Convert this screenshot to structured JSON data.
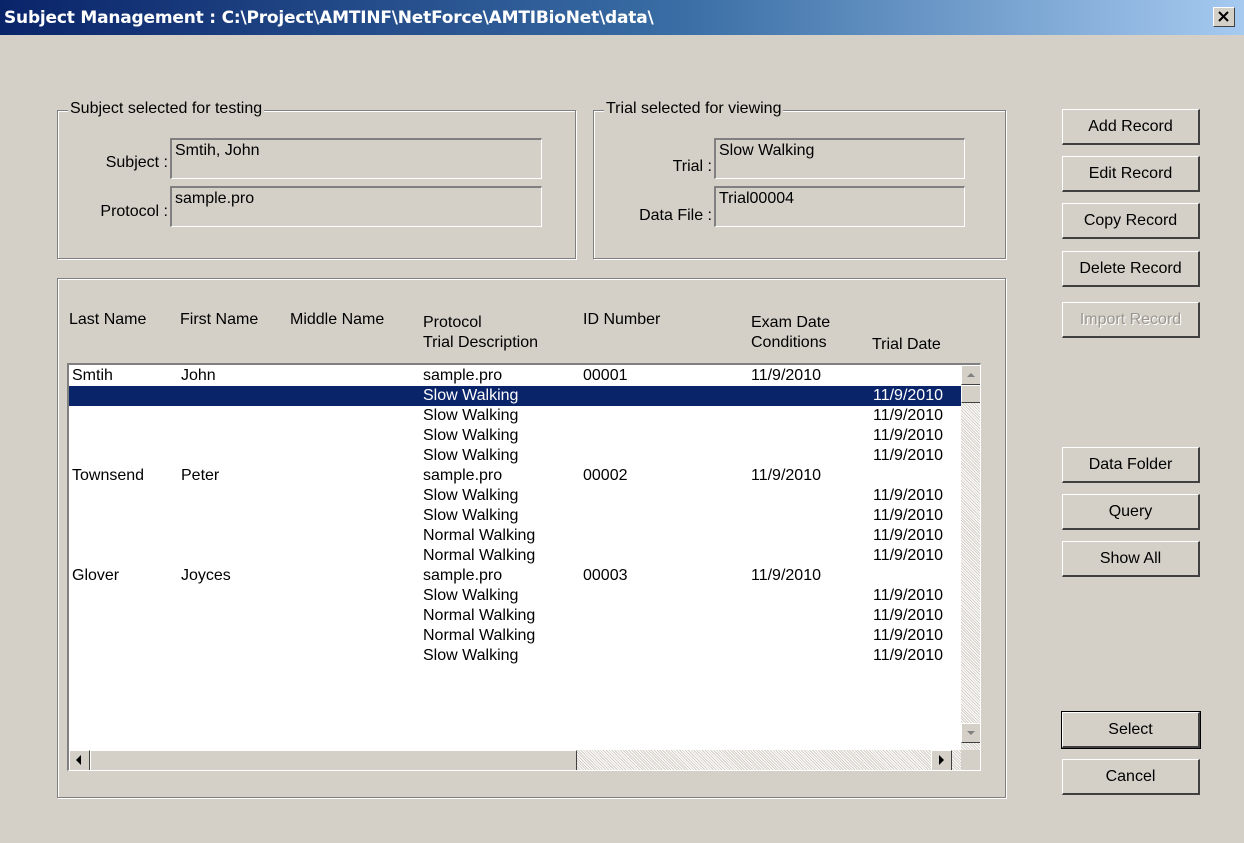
{
  "window": {
    "title": "Subject Management : C:\\Project\\AMTINF\\NetForce\\AMTIBioNet\\data\\"
  },
  "subject_group": {
    "title": "Subject selected for testing",
    "subject_label": "Subject :",
    "subject_value": "Smtih, John",
    "protocol_label": "Protocol :",
    "protocol_value": "sample.pro"
  },
  "trial_group": {
    "title": "Trial selected for viewing",
    "trial_label": "Trial :",
    "trial_value": "Slow Walking",
    "datafile_label": "Data File :",
    "datafile_value": "Trial00004"
  },
  "buttons": {
    "add": "Add Record",
    "edit": "Edit Record",
    "copy": "Copy Record",
    "delete": "Delete Record",
    "import": "Import Record",
    "data_folder": "Data Folder",
    "query": "Query",
    "show_all": "Show All",
    "select": "Select",
    "cancel": "Cancel"
  },
  "list": {
    "headers": {
      "last_name": "Last Name",
      "first_name": "First Name",
      "middle_name": "Middle Name",
      "protocol": "Protocol",
      "trial_description": "Trial Description",
      "id_number": "ID Number",
      "exam_date": "Exam Date",
      "conditions": "Conditions",
      "trial_date": "Trial Date"
    },
    "selected_row": 1,
    "rows": [
      {
        "last": "Smtih",
        "first": "John",
        "middle": "",
        "desc": "sample.pro",
        "id": "00001",
        "exam": "11/9/2010",
        "trial_date": ""
      },
      {
        "last": "",
        "first": "",
        "middle": "",
        "desc": "Slow Walking",
        "id": "",
        "exam": "",
        "trial_date": "11/9/2010"
      },
      {
        "last": "",
        "first": "",
        "middle": "",
        "desc": "Slow Walking",
        "id": "",
        "exam": "",
        "trial_date": "11/9/2010"
      },
      {
        "last": "",
        "first": "",
        "middle": "",
        "desc": "Slow Walking",
        "id": "",
        "exam": "",
        "trial_date": "11/9/2010"
      },
      {
        "last": "",
        "first": "",
        "middle": "",
        "desc": "Slow Walking",
        "id": "",
        "exam": "",
        "trial_date": "11/9/2010"
      },
      {
        "last": "Townsend",
        "first": "Peter",
        "middle": "",
        "desc": "sample.pro",
        "id": "00002",
        "exam": "11/9/2010",
        "trial_date": ""
      },
      {
        "last": "",
        "first": "",
        "middle": "",
        "desc": "Slow Walking",
        "id": "",
        "exam": "",
        "trial_date": "11/9/2010"
      },
      {
        "last": "",
        "first": "",
        "middle": "",
        "desc": "Slow Walking",
        "id": "",
        "exam": "",
        "trial_date": "11/9/2010"
      },
      {
        "last": "",
        "first": "",
        "middle": "",
        "desc": "Normal Walking",
        "id": "",
        "exam": "",
        "trial_date": "11/9/2010"
      },
      {
        "last": "",
        "first": "",
        "middle": "",
        "desc": "Normal Walking",
        "id": "",
        "exam": "",
        "trial_date": "11/9/2010"
      },
      {
        "last": "Glover",
        "first": "Joyces",
        "middle": "",
        "desc": "sample.pro",
        "id": "00003",
        "exam": "11/9/2010",
        "trial_date": ""
      },
      {
        "last": "",
        "first": "",
        "middle": "",
        "desc": "Slow Walking",
        "id": "",
        "exam": "",
        "trial_date": "11/9/2010"
      },
      {
        "last": "",
        "first": "",
        "middle": "",
        "desc": "Normal Walking",
        "id": "",
        "exam": "",
        "trial_date": "11/9/2010"
      },
      {
        "last": "",
        "first": "",
        "middle": "",
        "desc": "Normal Walking",
        "id": "",
        "exam": "",
        "trial_date": "11/9/2010"
      },
      {
        "last": "",
        "first": "",
        "middle": "",
        "desc": "Slow Walking",
        "id": "",
        "exam": "",
        "trial_date": "11/9/2010"
      }
    ]
  },
  "icons": {
    "close": "close-icon",
    "scroll_up": "arrow-up-icon",
    "scroll_down": "arrow-down-icon",
    "scroll_left": "arrow-left-icon",
    "scroll_right": "arrow-right-icon"
  }
}
